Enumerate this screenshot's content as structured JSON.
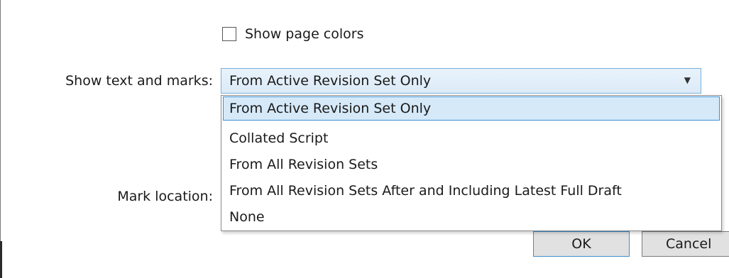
{
  "show_page_colors": {
    "label": "Show page colors",
    "checked": false
  },
  "show_text_marks": {
    "label": "Show text and marks:",
    "selected": "From Active Revision Set Only",
    "options": [
      "From Active Revision Set Only",
      "Collated Script",
      "From All Revision Sets",
      "From All Revision Sets After and Including Latest Full Draft",
      "None"
    ]
  },
  "mark_location": {
    "label": "Mark location:"
  },
  "buttons": {
    "ok": "OK",
    "cancel": "Cancel"
  },
  "icons": {
    "dropdown_arrow": "chevron-down-icon"
  }
}
